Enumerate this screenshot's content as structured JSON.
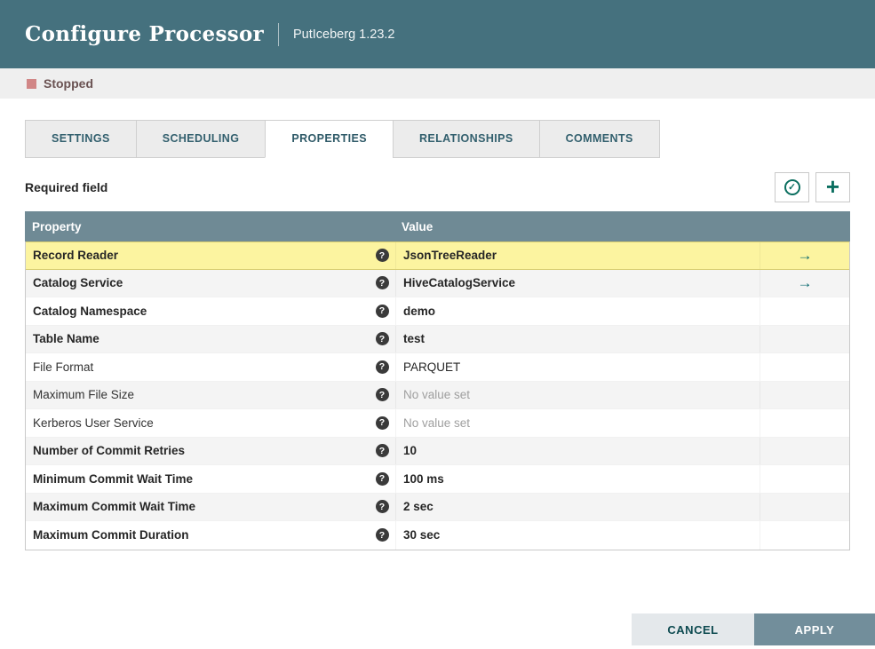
{
  "header": {
    "title": "Configure Processor",
    "subtitle": "PutIceberg 1.23.2"
  },
  "status": {
    "label": "Stopped",
    "color": "#d18686"
  },
  "tabs": [
    {
      "label": "SETTINGS",
      "active": false
    },
    {
      "label": "SCHEDULING",
      "active": false
    },
    {
      "label": "PROPERTIES",
      "active": true
    },
    {
      "label": "RELATIONSHIPS",
      "active": false
    },
    {
      "label": "COMMENTS",
      "active": false
    }
  ],
  "toolbar": {
    "required_field_label": "Required field"
  },
  "icons": {
    "help": "?",
    "go_to": "→",
    "check": "✓",
    "plus": "+"
  },
  "table": {
    "headers": [
      "Property",
      "Value"
    ],
    "rows": [
      {
        "name": "Record Reader",
        "value": "JsonTreeReader",
        "required": true,
        "selected": true,
        "has_go_to": true,
        "value_set": true
      },
      {
        "name": "Catalog Service",
        "value": "HiveCatalogService",
        "required": true,
        "selected": false,
        "has_go_to": true,
        "value_set": true
      },
      {
        "name": "Catalog Namespace",
        "value": "demo",
        "required": true,
        "selected": false,
        "has_go_to": false,
        "value_set": true
      },
      {
        "name": "Table Name",
        "value": "test",
        "required": true,
        "selected": false,
        "has_go_to": false,
        "value_set": true
      },
      {
        "name": "File Format",
        "value": "PARQUET",
        "required": false,
        "selected": false,
        "has_go_to": false,
        "value_set": true
      },
      {
        "name": "Maximum File Size",
        "value": "No value set",
        "required": false,
        "selected": false,
        "has_go_to": false,
        "value_set": false
      },
      {
        "name": "Kerberos User Service",
        "value": "No value set",
        "required": false,
        "selected": false,
        "has_go_to": false,
        "value_set": false
      },
      {
        "name": "Number of Commit Retries",
        "value": "10",
        "required": true,
        "selected": false,
        "has_go_to": false,
        "value_set": true
      },
      {
        "name": "Minimum Commit Wait Time",
        "value": "100 ms",
        "required": true,
        "selected": false,
        "has_go_to": false,
        "value_set": true
      },
      {
        "name": "Maximum Commit Wait Time",
        "value": "2 sec",
        "required": true,
        "selected": false,
        "has_go_to": false,
        "value_set": true
      },
      {
        "name": "Maximum Commit Duration",
        "value": "30 sec",
        "required": true,
        "selected": false,
        "has_go_to": false,
        "value_set": true
      }
    ]
  },
  "footer": {
    "cancel_label": "CANCEL",
    "apply_label": "APPLY"
  },
  "colors": {
    "header_bg": "#45717e",
    "table_header_bg": "#6f8a95",
    "selected_row_bg": "#fcf4a0",
    "accent_teal": "#0a6e5f",
    "apply_bg": "#728e9b",
    "cancel_bg": "#e4e8eb"
  }
}
